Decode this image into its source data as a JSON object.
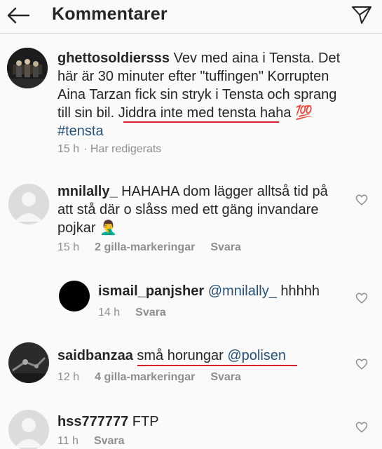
{
  "header": {
    "title": "Kommentarer"
  },
  "caption": {
    "username": "ghettosoldiersss",
    "text_line1": "Vev med aina i Tensta. Det",
    "line2": "här är 30 minuter efter \"tuffingen\" Korrupten",
    "line3": "Aina Tarzan fick sin stryk i Tensta och sprang",
    "line4_start": "till sin bil. ",
    "line4_highlight": "Jiddra inte med tensta haha",
    "emoji": "💯",
    "hashtag": "#tensta",
    "time": "15 h",
    "edited": "· Har redigerats"
  },
  "comments": [
    {
      "username": "mnilally_",
      "line1": "HAHAHA dom lägger alltså tid på",
      "line2": "att stå där o slåss med ett gäng invandare",
      "line3": "pojkar",
      "emoji": "🤦‍♂️",
      "time": "15 h",
      "likes": "2 gilla-markeringar",
      "reply": "Svara"
    },
    {
      "username": "ismail_panjsher",
      "mention": "@mnilally_",
      "text": "hhhhh",
      "time": "14 h",
      "reply": "Svara"
    },
    {
      "username": "saidbanzaa",
      "text": "små horungar",
      "mention": "@polisen",
      "time": "12 h",
      "likes": "4 gilla-markeringar",
      "reply": "Svara"
    },
    {
      "username": "hss777777",
      "text": "FTP",
      "time": "11 h",
      "reply": "Svara"
    }
  ],
  "colors": {
    "mention": "#24527a",
    "underline": "#d8202a",
    "meta": "#8e8e8e"
  }
}
